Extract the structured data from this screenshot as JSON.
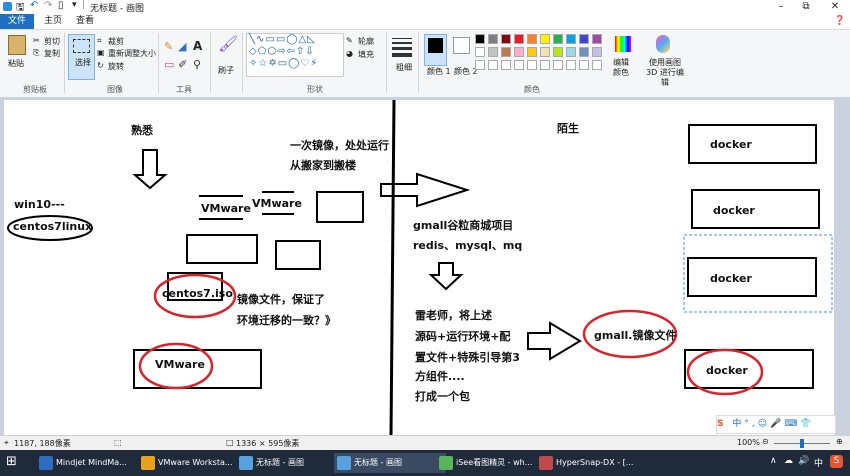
{
  "window": {
    "title": "无标题 - 画图"
  },
  "menu": {
    "file": "文件",
    "home": "主页",
    "view": "查看"
  },
  "ribbon": {
    "clipboard": {
      "paste": "粘贴",
      "cut": "剪切",
      "copy": "复制",
      "label": "剪贴板"
    },
    "image": {
      "select": "选择",
      "crop": "裁剪",
      "resize": "重新调整大小",
      "rotate": "旋转",
      "label": "图像"
    },
    "tools": {
      "label": "工具"
    },
    "brushes": {
      "label": "刷子"
    },
    "shapes": {
      "outline": "轮廓",
      "fill": "填充",
      "label": "形状"
    },
    "size": {
      "label": "粗细"
    },
    "colors": {
      "color1": "颜色 1",
      "color2": "颜色 2",
      "edit": "编辑颜色",
      "paint3d": "使用画图 3D 进行编辑",
      "label": "颜色",
      "palette": [
        "#000000",
        "#7f7f7f",
        "#880015",
        "#ed1c24",
        "#ff7f27",
        "#fff200",
        "#22b14c",
        "#00a2e8",
        "#3f48cc",
        "#a349a4",
        "#ffffff",
        "#c3c3c3",
        "#b97a57",
        "#ffaec9",
        "#ffc90e",
        "#efe4b0",
        "#b5e61d",
        "#99d9ea",
        "#7092be",
        "#c8bfe7"
      ]
    }
  },
  "canvas": {
    "familiar": "熟悉",
    "stranger": "陌生",
    "slogan1": "一次镜像，处处运行",
    "slogan2": "从搬家到搬楼",
    "win10": "win10---",
    "centos_linux": "centos7linux",
    "vmware_a": "VMware",
    "vmware_b": "VMware",
    "centos_iso": "centos7.iso",
    "mirror1": "镜像文件，保证了",
    "mirror2": "环境迁移的一致？》",
    "vmware_bottom": "VMware",
    "gmall1": "gmall谷粒商城项目",
    "gmall2": "redis、mysql、mq",
    "lei1": "雷老师，将上述",
    "lei2": "源码+运行环境+配",
    "lei3": "置文件+特殊引导第3",
    "lei4": "方组件....",
    "lei5": "打成一个包",
    "gmall_image": "gmall.镜像文件",
    "docker1": "docker",
    "docker2": "docker",
    "docker3": "docker",
    "docker4": "docker"
  },
  "status": {
    "cursor_pos": "1187, 188像素",
    "image_size": "1336 × 595像素",
    "zoom": "100%"
  },
  "taskbar": {
    "items": [
      "Mindjet MindMa...",
      "VMware Worksta...",
      "无标题 - 画图",
      "无标题 - 画图",
      "iSee看图精灵 - wh...",
      "HyperSnap-DX - [..."
    ],
    "ime": "中"
  }
}
